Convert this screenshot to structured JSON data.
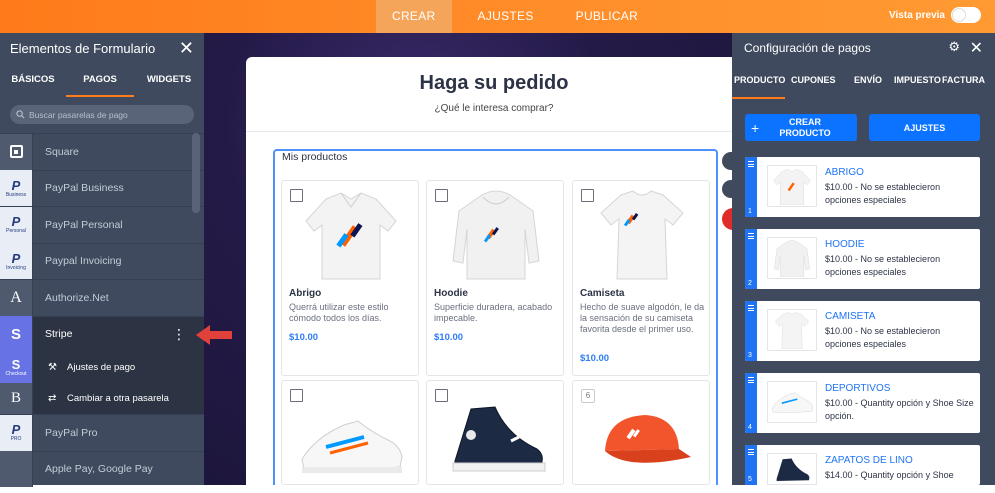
{
  "topbar": {
    "tabs": [
      "CREAR",
      "AJUSTES",
      "PUBLICAR"
    ],
    "preview_label": "Vista previa",
    "accent": "#ff7a1a"
  },
  "left_panel": {
    "title": "Elementos de Formulario",
    "tabs": [
      "BÁSICOS",
      "PAGOS",
      "WIDGETS"
    ],
    "search_placeholder": "Buscar pasarelas de pago",
    "gateways": [
      {
        "label": "Square",
        "icon": "square-icon",
        "sub": ""
      },
      {
        "label": "PayPal Business",
        "icon": "paypal-icon",
        "sub": "Business"
      },
      {
        "label": "PayPal Personal",
        "icon": "paypal-icon",
        "sub": "Personal"
      },
      {
        "label": "Paypal Invoicing",
        "icon": "paypal-icon",
        "sub": "Invoicing"
      },
      {
        "label": "Authorize.Net",
        "icon": "authorize-net-icon",
        "sub": ""
      },
      {
        "label": "Stripe",
        "icon": "stripe-icon",
        "sub": ""
      },
      {
        "label": "",
        "icon": "stripe-checkout-icon",
        "sub": "Checkout"
      },
      {
        "label": "",
        "icon": "braintree-icon",
        "sub": ""
      },
      {
        "label": "PayPal Pro",
        "icon": "paypal-icon",
        "sub": "PRO"
      },
      {
        "label": "Apple Pay, Google Pay",
        "icon": "apple-pay-icon",
        "sub": ""
      }
    ],
    "submenu": [
      {
        "label": "Ajustes de pago",
        "icon": "magic-wand-icon"
      },
      {
        "label": "Cambiar a otra pasarela",
        "icon": "swap-arrows-icon"
      }
    ]
  },
  "form": {
    "title": "Haga su pedido",
    "subtitle": "¿Qué le interesa comprar?",
    "products_label": "Mis productos",
    "products": [
      {
        "name": "Abrigo",
        "desc": "Querrá utilizar este estilo cómodo todos los días.",
        "price": "$10.00"
      },
      {
        "name": "Hoodie",
        "desc": "Superficie duradera, acabado impecable.",
        "price": "$10.00"
      },
      {
        "name": "Camiseta",
        "desc": "Hecho de suave algodón, le da la sensación de su camiseta favorita desde el primer uso.",
        "price": "$10.00"
      },
      {
        "name": "",
        "desc": "",
        "price": ""
      },
      {
        "name": "",
        "desc": "",
        "price": ""
      },
      {
        "name": "",
        "desc": "",
        "price": "",
        "badge": "6"
      }
    ]
  },
  "right_panel": {
    "title": "Configuración de pagos",
    "tabs": [
      "PRODUCTO",
      "CUPONES",
      "ENVÍO",
      "IMPUESTO",
      "FACTURA"
    ],
    "create_button": "CREAR PRODUCTO",
    "settings_button": "AJUSTES",
    "products": [
      {
        "name": "ABRIGO",
        "desc": "$10.00 - No se establecieron opciones especiales",
        "num": "1"
      },
      {
        "name": "HOODIE",
        "desc": "$10.00 - No se establecieron opciones especiales",
        "num": "2"
      },
      {
        "name": "CAMISETA",
        "desc": "$10.00 - No se establecieron opciones especiales",
        "num": "3"
      },
      {
        "name": "DEPORTIVOS",
        "desc": "$10.00 - Quantity opción y Shoe Size opción.",
        "num": "4"
      },
      {
        "name": "ZAPATOS DE LINO",
        "desc": "$14.00 - Quantity opción y Shoe",
        "num": "5"
      }
    ]
  }
}
